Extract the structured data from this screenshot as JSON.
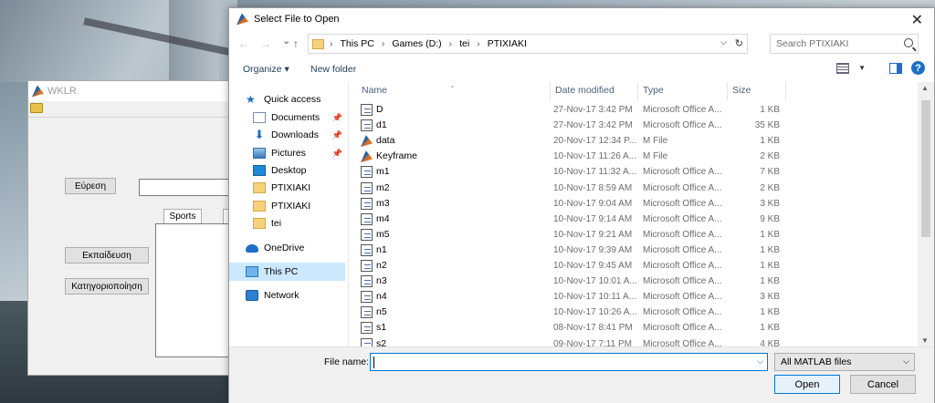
{
  "wklr": {
    "title": "WKLR",
    "search_button": "Εύρεση",
    "tab_sports": "Sports",
    "train_button": "Εκπαίδευση",
    "classify_button": "Κατηγοριοποίηση"
  },
  "dialog": {
    "title": "Select File to Open",
    "breadcrumb": [
      "This PC",
      "Games (D:)",
      "tei",
      "PTIXIAKI"
    ],
    "search_placeholder": "Search PTIXIAKI",
    "organize_label": "Organize",
    "new_folder_label": "New folder",
    "nav": [
      {
        "label": "Quick access",
        "icon": "star-icon"
      },
      {
        "label": "Documents",
        "icon": "documents-icon",
        "pinned": true
      },
      {
        "label": "Downloads",
        "icon": "downloads-icon",
        "pinned": true
      },
      {
        "label": "Pictures",
        "icon": "pictures-icon",
        "pinned": true
      },
      {
        "label": "Desktop",
        "icon": "desktop-icon"
      },
      {
        "label": "PTIXIAKI",
        "icon": "folder-icon"
      },
      {
        "label": "PTIXIAKI",
        "icon": "folder-icon"
      },
      {
        "label": "tei",
        "icon": "folder-icon"
      },
      {
        "label": "OneDrive",
        "icon": "onedrive-icon"
      },
      {
        "label": "This PC",
        "icon": "this-pc-icon",
        "selected": true
      },
      {
        "label": "Network",
        "icon": "network-icon"
      }
    ],
    "columns": {
      "name": "Name",
      "date": "Date modified",
      "type": "Type",
      "size": "Size"
    },
    "files": [
      {
        "name": "D",
        "date": "27-Nov-17 3:42 PM",
        "type": "Microsoft Office A...",
        "size": "1 KB",
        "icon": "fig"
      },
      {
        "name": "d1",
        "date": "27-Nov-17 3:42 PM",
        "type": "Microsoft Office A...",
        "size": "35 KB",
        "icon": "fig"
      },
      {
        "name": "data",
        "date": "20-Nov-17 12:34 P...",
        "type": "M File",
        "size": "1 KB",
        "icon": "m"
      },
      {
        "name": "Keyframe",
        "date": "10-Nov-17 11:26 A...",
        "type": "M File",
        "size": "2 KB",
        "icon": "m"
      },
      {
        "name": "m1",
        "date": "10-Nov-17 11:32 A...",
        "type": "Microsoft Office A...",
        "size": "7 KB",
        "icon": "fig"
      },
      {
        "name": "m2",
        "date": "10-Nov-17 8:59 AM",
        "type": "Microsoft Office A...",
        "size": "2 KB",
        "icon": "fig"
      },
      {
        "name": "m3",
        "date": "10-Nov-17 9:04 AM",
        "type": "Microsoft Office A...",
        "size": "3 KB",
        "icon": "fig"
      },
      {
        "name": "m4",
        "date": "10-Nov-17 9:14 AM",
        "type": "Microsoft Office A...",
        "size": "9 KB",
        "icon": "fig"
      },
      {
        "name": "m5",
        "date": "10-Nov-17 9:21 AM",
        "type": "Microsoft Office A...",
        "size": "1 KB",
        "icon": "fig"
      },
      {
        "name": "n1",
        "date": "10-Nov-17 9:39 AM",
        "type": "Microsoft Office A...",
        "size": "1 KB",
        "icon": "fig"
      },
      {
        "name": "n2",
        "date": "10-Nov-17 9:45 AM",
        "type": "Microsoft Office A...",
        "size": "1 KB",
        "icon": "fig"
      },
      {
        "name": "n3",
        "date": "10-Nov-17 10:01 A...",
        "type": "Microsoft Office A...",
        "size": "1 KB",
        "icon": "fig"
      },
      {
        "name": "n4",
        "date": "10-Nov-17 10:11 A...",
        "type": "Microsoft Office A...",
        "size": "3 KB",
        "icon": "fig"
      },
      {
        "name": "n5",
        "date": "10-Nov-17 10:26 A...",
        "type": "Microsoft Office A...",
        "size": "1 KB",
        "icon": "fig"
      },
      {
        "name": "s1",
        "date": "08-Nov-17 8:41 PM",
        "type": "Microsoft Office A...",
        "size": "1 KB",
        "icon": "fig"
      },
      {
        "name": "s2",
        "date": "09-Nov-17 7:11 PM",
        "type": "Microsoft Office A...",
        "size": "4 KB",
        "icon": "fig"
      }
    ],
    "file_name_label": "File name:",
    "file_name_value": "",
    "file_type": "All MATLAB files",
    "open_label": "Open",
    "cancel_label": "Cancel"
  }
}
